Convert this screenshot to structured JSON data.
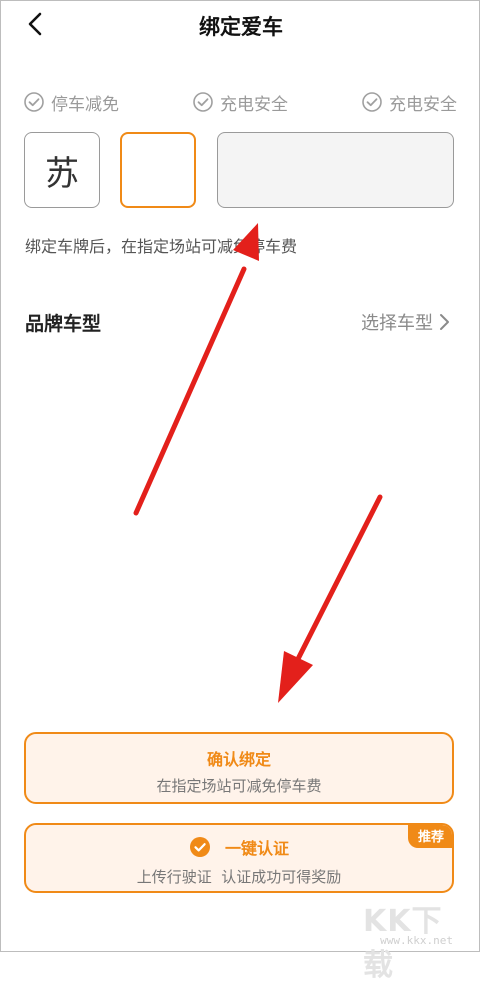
{
  "header": {
    "title": "绑定爱车"
  },
  "features": [
    "停车减免",
    "充电安全",
    "充电安全"
  ],
  "plate": {
    "province": "苏",
    "letter_value": "",
    "number_value": ""
  },
  "hint": "绑定车牌后，在指定场站可减免停车费",
  "brand": {
    "label": "品牌车型",
    "action": "选择车型"
  },
  "confirm": {
    "title": "确认绑定",
    "subtitle": "在指定场站可减免停车费"
  },
  "verify": {
    "title": "一键认证",
    "subtitle": "上传行驶证  认证成功可得奖励",
    "tag": "推荐"
  },
  "watermark": {
    "logo": "KK下载",
    "url": "www.kkx.net"
  },
  "colors": {
    "accent": "#f08a17",
    "annotation_arrow": "#e3201b",
    "card_bg": "#fff3ea"
  }
}
